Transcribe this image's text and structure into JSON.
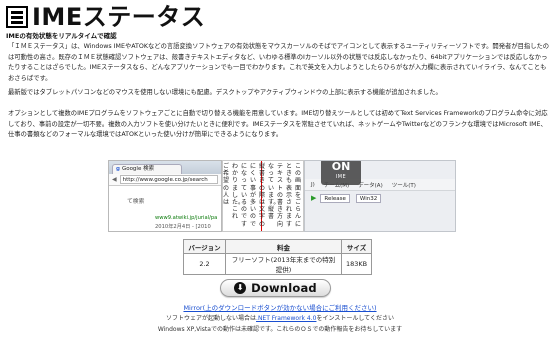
{
  "header": {
    "title": "IMEステータス",
    "subtitle": "IMEの有効状態をリアルタイムで確認"
  },
  "paragraphs": {
    "p1": "「ＩＭＥステータス」は、Windows IMEやATOKなどの言語変換ソフトウェアの有効状態をマウスカーソルのそばでアイコンとして表示するユーティリティーソフトです。開発者が目指したのは可動性の高さ。既存のＩＭＥ状態確認ソフトウェアは、殻書きテキストエディタなど、いわゆる標準のIカーソル以外の状態では反応しなかったり、64bitアプリケーションでは反応しなかったりすることはざらでした。IMEステータスなら、どんなアプリケーションでも一目でわかります。これで英文を入力しようとしたらひらがなが入力欄に表示されていイライラ、なんてこともおさらばです。",
    "p2": "最新版ではタブレットパソコンなどのマウスを使用しない環境にも配慮。デスクトップやアクティブウィンドウの上部に表示する機能が追加されました。",
    "p3": "オプションとして複数のIMEプログラムをソフトウェアごとに自動で切り替える機能を用意しています。IME切り替えツールとしては初めてText Services Frameworkのプログラム命令に対応しており、事前の設定が一切不要。複数の入力ソフトを使い分けたいときに便利です。IMEステータスを常駐させていれば、ネットゲームやTwitterなどのフランクな環境ではMicrosoft IME、仕事の書類などのフォーマルな環境ではATOKといった使い分けが簡単にできるようになります。"
  },
  "collage": {
    "browser": {
      "tab_label": "Google 検索",
      "url": "http://www.google.co.jp/search",
      "search_text": "て検索",
      "green_link": "www9.atwiki.jp/jurial/pa",
      "date": "2010年2月4日 - [2010"
    },
    "textpane": {
      "columns": [
        "この画面をごらんに",
        "ときも表示されます",
        "テキストの書き方向",
        "なっています。縦書",
        "縦書きの際は文字の",
        "にくい事が多いので",
        "になっているのです",
        "わかりました。これ",
        "ご希望の人は"
      ]
    },
    "toolbar": {
      "badge_state": "ON",
      "badge_label": "IME",
      "menu": [
        "J)",
        "チーム(M)",
        "データ(A)",
        "ツール(T)"
      ],
      "config_select": "Release",
      "platform_select": "Win32"
    }
  },
  "version_table": {
    "headers": [
      "バージョン",
      "料金",
      "サイズ"
    ],
    "rows": [
      [
        "2.2",
        "フリーソフト(2013年末までの特別提供)",
        "183KB"
      ]
    ]
  },
  "download": {
    "label": "Download",
    "icon": "download-arrow-icon"
  },
  "mirror_link": "Mirror(上のダウンロードボタンが効かない場合にご利用ください)",
  "note1_prefix": "ソフトウェアが起動しない場合は",
  "note1_link": ".NET Framework 4.0",
  "note1_suffix": "をインストールしてください",
  "note2": "Windows XP,Vistaでの動作は未確認です。これらのＯＳでの動作報告をお待ちしています"
}
